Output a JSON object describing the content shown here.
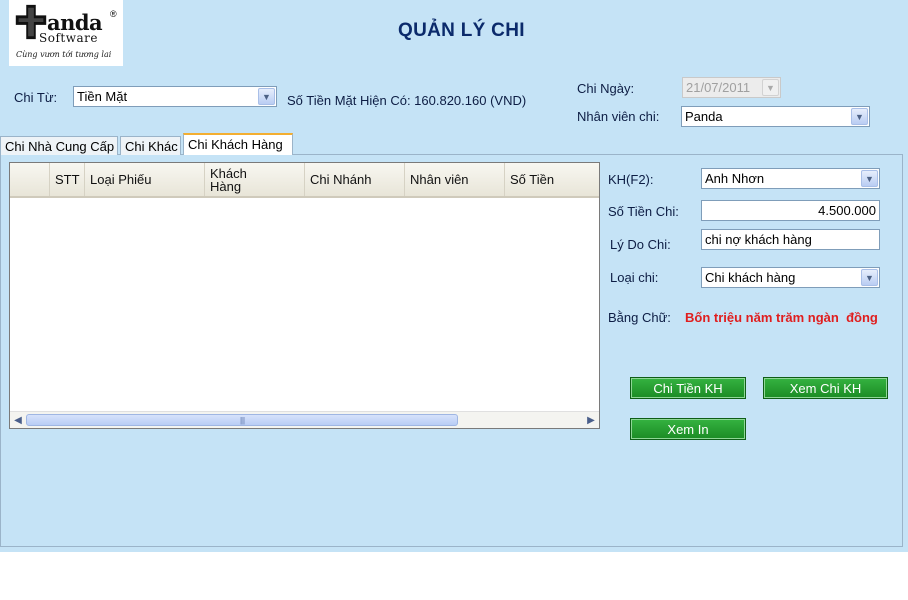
{
  "header": {
    "logo": {
      "brand": "anda",
      "registered": "®",
      "software": "Software",
      "tagline": "Cùng vươn tới tương lai"
    },
    "title": "QUẢN LÝ CHI"
  },
  "top": {
    "chi_tu_label": "Chi Từ:",
    "chi_tu_value": "Tiền Mặt",
    "balance_text": "Số Tiền Mặt Hiện Có: 160.820.160 (VND)",
    "chi_ngay_label": "Chi Ngày:",
    "chi_ngay_value": "21/07/2011",
    "nhan_vien_label": "Nhân viên chi:",
    "nhan_vien_value": "Panda"
  },
  "tabs": [
    {
      "label": "Chi Nhà Cung Cấp"
    },
    {
      "label": "Chi Khác"
    },
    {
      "label": "Chi Khách Hàng",
      "active": true
    }
  ],
  "grid": {
    "columns": [
      "",
      "STT",
      "Loại Phiếu",
      "Khách Hàng",
      "Chi Nhánh",
      "Nhân viên",
      "Số Tiền"
    ],
    "rows": [],
    "thumb_glyph": "||||"
  },
  "form": {
    "kh_label": "KH(F2):",
    "kh_value": "Anh Nhơn",
    "so_tien_label": "Số Tiền Chi:",
    "so_tien_value": "4.500.000",
    "ly_do_label": "Lý Do Chi:",
    "ly_do_value": "chi nợ khách hàng",
    "loai_chi_label": "Loại chi:",
    "loai_chi_value": "Chi khách hàng",
    "bang_chu_label": "Bằng Chữ:",
    "bang_chu_value": "Bốn triệu năm trăm ngàn  đồng"
  },
  "buttons": {
    "chi_tien_kh": "Chi Tiền KH",
    "xem_chi_kh": "Xem Chi KH",
    "xem_in": "Xem In"
  },
  "colors": {
    "background": "#c5e3f6",
    "title": "#0b2a6b",
    "button_green": "#1b8b24",
    "amount_words": "#e01e1e",
    "active_tab_accent": "#f3ae31"
  },
  "icons": {
    "dropdown": "chevron-down-icon",
    "scroll_left": "arrow-left-icon",
    "scroll_right": "arrow-right-icon"
  }
}
